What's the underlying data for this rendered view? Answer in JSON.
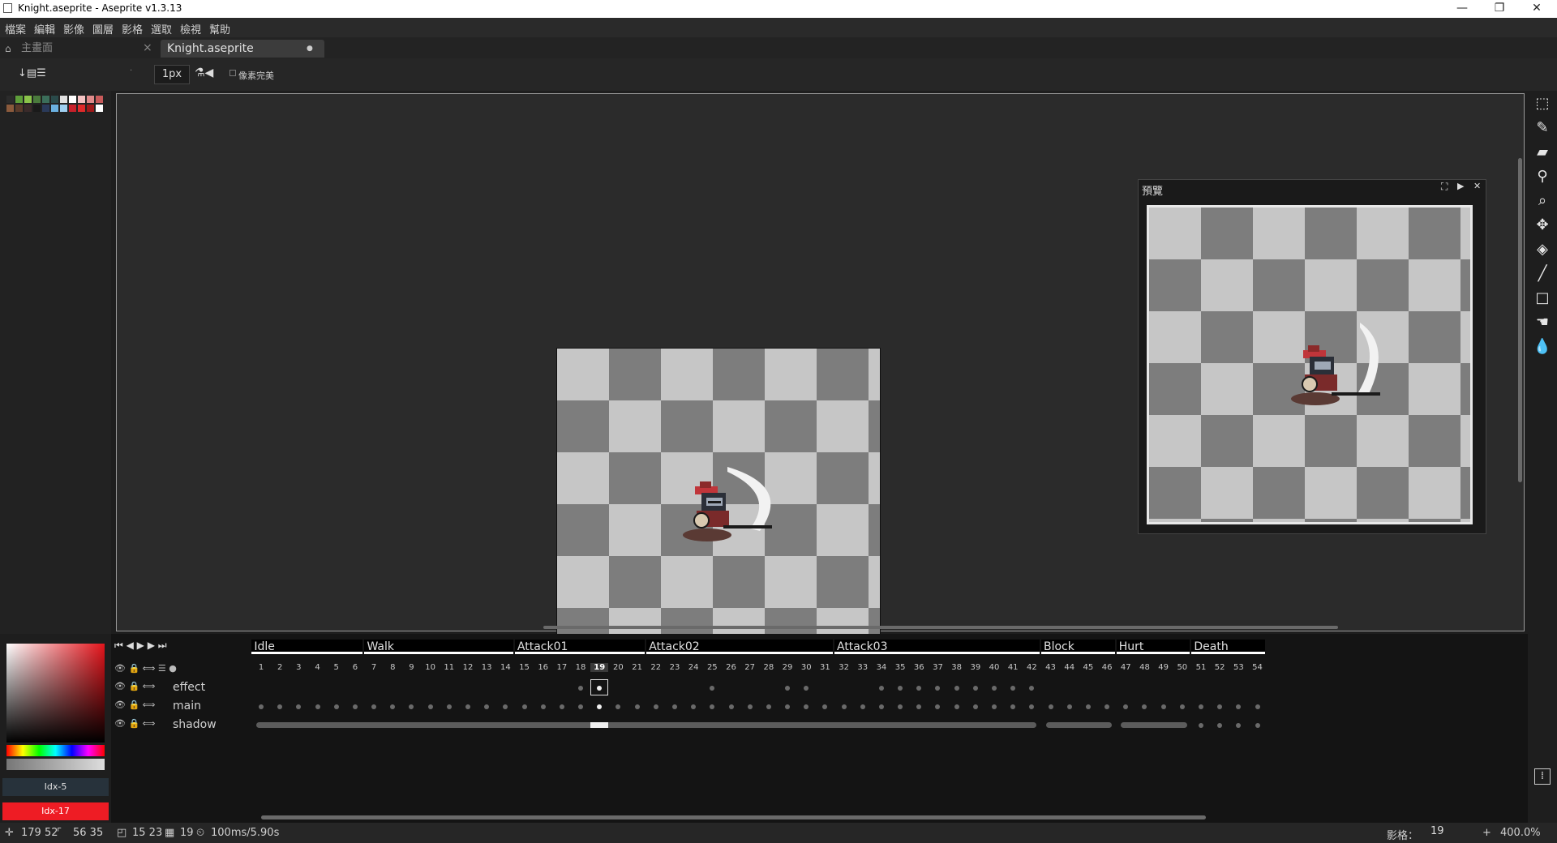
{
  "window": {
    "title": "Knight.aseprite - Aseprite v1.3.13",
    "buttons": {
      "minimize": "—",
      "maximize": "❐",
      "close": "✕"
    }
  },
  "menu": [
    "檔案",
    "編輯",
    "影像",
    "圖層",
    "影格",
    "選取",
    "檢視",
    "幫助"
  ],
  "tabs": [
    {
      "label": "主畫面",
      "close": "×"
    },
    {
      "label": "Knight.aseprite",
      "modified": "●"
    }
  ],
  "context": {
    "brush_size": "1px",
    "pixel_perfect_label": "像素完美"
  },
  "palette_colors": [
    "#2b2b2b",
    "#5e9e3a",
    "#8bc34a",
    "#4a7a3c",
    "#3b6e5a",
    "#2a4a4a",
    "#e0e0e0",
    "#ffffff",
    "#f4c2c2",
    "#e08a8a",
    "#c85a5a",
    "#8b5a3c",
    "#5a3a2a",
    "#3a2a2a",
    "#1a1a1a",
    "#2a3a5a",
    "#6ab0e0",
    "#a0d0f0",
    "#c8202a",
    "#e02a2a",
    "#a01a1a",
    "#ffffff"
  ],
  "preview": {
    "title": "預覽"
  },
  "tools": [
    "marquee-icon",
    "pencil-icon",
    "eraser-icon",
    "eyedropper-icon",
    "zoom-icon",
    "move-icon",
    "paint-bucket-icon",
    "line-icon",
    "rectangle-icon",
    "smudge-icon",
    "blur-icon"
  ],
  "timeline": {
    "tags": [
      {
        "name": "Idle",
        "from": 1,
        "to": 6
      },
      {
        "name": "Walk",
        "from": 7,
        "to": 14
      },
      {
        "name": "Attack01",
        "from": 15,
        "to": 21
      },
      {
        "name": "Attack02",
        "from": 22,
        "to": 31
      },
      {
        "name": "Attack03",
        "from": 32,
        "to": 42
      },
      {
        "name": "Block",
        "from": 43,
        "to": 46
      },
      {
        "name": "Hurt",
        "from": 47,
        "to": 50
      },
      {
        "name": "Death",
        "from": 51,
        "to": 54
      }
    ],
    "frame_count": 54,
    "current_frame": 19,
    "layers": [
      {
        "name": "effect",
        "cels": [
          18,
          19,
          25,
          29,
          30,
          34,
          35,
          36,
          37,
          38,
          39,
          40,
          41,
          42
        ]
      },
      {
        "name": "main",
        "cels": "all"
      },
      {
        "name": "shadow",
        "linked": [
          [
            1,
            42
          ],
          [
            43,
            46
          ],
          [
            47,
            50
          ]
        ],
        "cels": [
          51,
          52,
          53,
          54
        ]
      }
    ]
  },
  "colors": {
    "foreground_label": "Idx-5",
    "foreground": "#27323b",
    "background_label": "Idx-17",
    "background": "#ee1c24"
  },
  "status": {
    "cursor_pos": "179 52",
    "selection_size": "56 35",
    "sprite_size": "15 23",
    "frame": "19",
    "duration": "100ms/5.90s",
    "frame_label": "影格：",
    "frame_value": "19",
    "zoom": "400.0%"
  }
}
